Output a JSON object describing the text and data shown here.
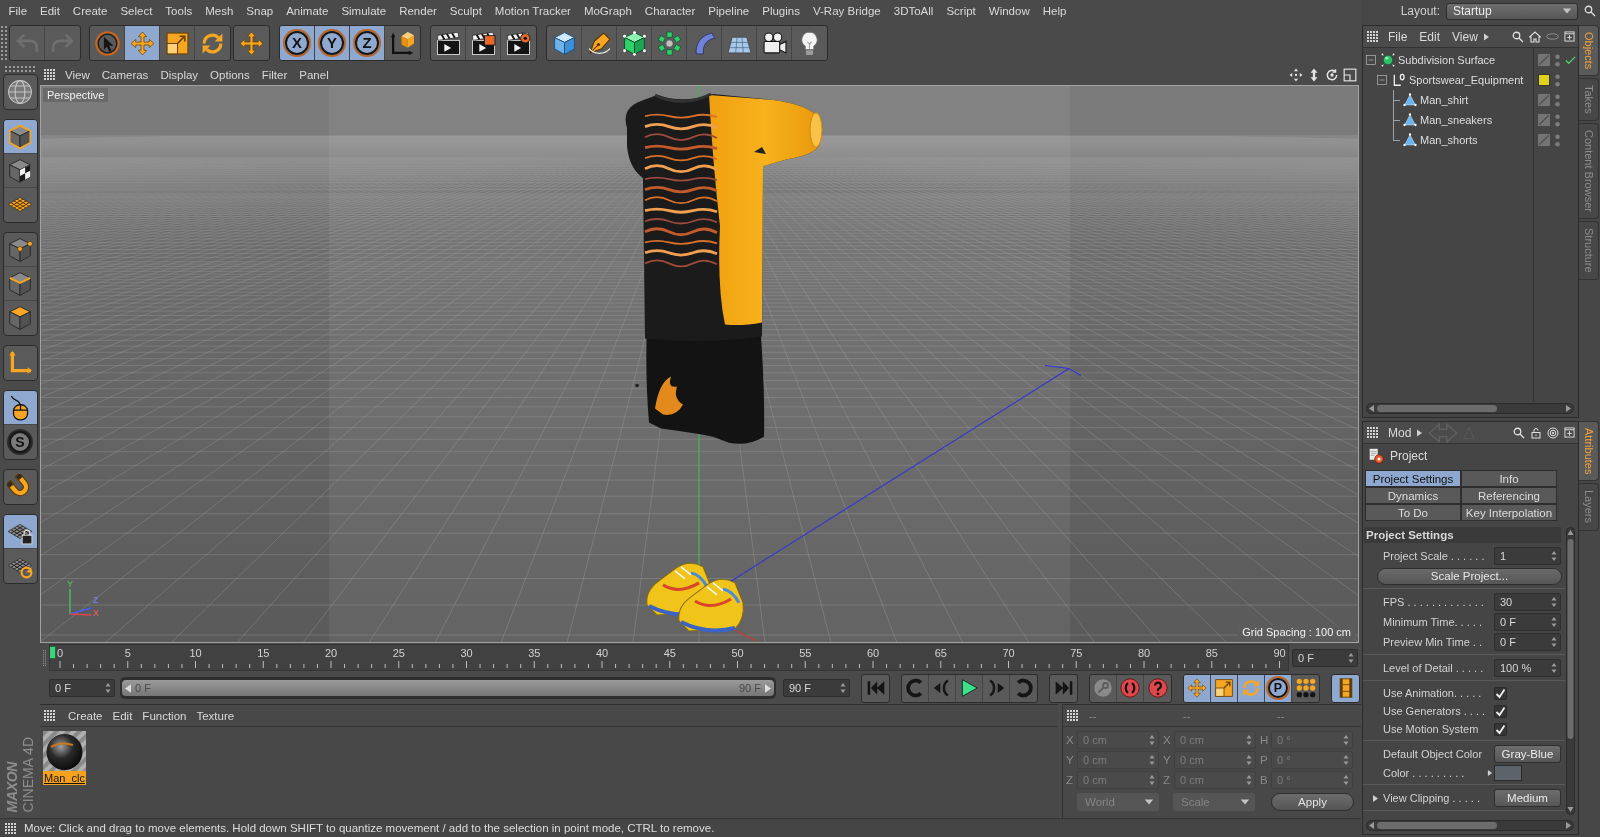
{
  "menu_bar": {
    "items": [
      "File",
      "Edit",
      "Create",
      "Select",
      "Tools",
      "Mesh",
      "Snap",
      "Animate",
      "Simulate",
      "Render",
      "Sculpt",
      "Motion Tracker",
      "MoGraph",
      "Character",
      "Pipeline",
      "Plugins",
      "V-Ray Bridge",
      "3DToAll",
      "Script",
      "Window",
      "Help"
    ]
  },
  "layout": {
    "label": "Layout:",
    "value": "Startup"
  },
  "toolbar": {
    "groups": [
      [
        {
          "kind": "undo",
          "disabled": true
        },
        {
          "kind": "redo",
          "disabled": true
        }
      ],
      [
        {
          "kind": "select",
          "selected": false
        },
        {
          "kind": "move",
          "selected": true
        },
        {
          "kind": "scale",
          "selected": false
        },
        {
          "kind": "rotate",
          "selected": false
        }
      ],
      [
        {
          "kind": "move",
          "selected": false
        }
      ],
      [
        {
          "kind": "axis",
          "label": "X",
          "selected": true
        },
        {
          "kind": "axis",
          "label": "Y",
          "selected": true
        },
        {
          "kind": "axis",
          "label": "Z",
          "selected": true
        },
        {
          "kind": "coordinate-system",
          "selected": false
        }
      ],
      [
        {
          "kind": "render-view",
          "selected": false
        },
        {
          "kind": "render-picture-viewer",
          "selected": false
        },
        {
          "kind": "render-settings",
          "selected": false
        }
      ],
      [
        {
          "kind": "cube",
          "selected": false
        },
        {
          "kind": "pen",
          "selected": false
        },
        {
          "kind": "subdivision",
          "selected": false
        },
        {
          "kind": "cloner",
          "selected": false
        },
        {
          "kind": "bend",
          "selected": false
        },
        {
          "kind": "floor",
          "selected": false
        },
        {
          "kind": "camera",
          "selected": false
        },
        {
          "kind": "light",
          "selected": false
        }
      ]
    ]
  },
  "left_toolbar": {
    "groups": [
      [
        {
          "kind": "make-editable",
          "selected": false
        }
      ],
      [
        {
          "kind": "model",
          "selected": true
        },
        {
          "kind": "texture",
          "selected": false
        },
        {
          "kind": "workplane",
          "selected": false
        }
      ],
      [
        {
          "kind": "points",
          "selected": false
        },
        {
          "kind": "edges",
          "selected": false
        },
        {
          "kind": "polygons",
          "selected": false
        }
      ],
      [
        {
          "kind": "axis-mode",
          "selected": false
        }
      ],
      [
        {
          "kind": "tweak",
          "selected": true
        },
        {
          "kind": "solo",
          "label": "S",
          "selected": false
        }
      ],
      [
        {
          "kind": "snap",
          "selected": false
        }
      ],
      [
        {
          "kind": "workplane-lock",
          "selected": true
        },
        {
          "kind": "planar",
          "selected": false
        }
      ]
    ]
  },
  "viewport": {
    "menu": [
      "View",
      "Cameras",
      "Display",
      "Options",
      "Filter",
      "Panel"
    ],
    "camera": "Perspective",
    "grid_spacing": "Grid Spacing : 100 cm",
    "axis_gizmo": [
      "Y",
      "Z",
      "X"
    ]
  },
  "timeline": {
    "ruler_labels": [
      "0",
      "5",
      "10",
      "15",
      "20",
      "25",
      "30",
      "35",
      "40",
      "45",
      "50",
      "55",
      "60",
      "65",
      "70",
      "75",
      "80",
      "85",
      "90"
    ],
    "current_frame": "0 F",
    "min_field": "0 F",
    "range_slider": {
      "start": "0 F",
      "end": "90 F",
      "level": 1
    },
    "max_field": "90 F"
  },
  "transport": {
    "groups": [
      [
        {
          "kind": "go-start",
          "selected": false
        }
      ],
      [
        {
          "kind": "prev-key",
          "selected": false
        },
        {
          "kind": "prev-frame",
          "selected": false
        },
        {
          "kind": "play",
          "selected": false
        },
        {
          "kind": "next-frame",
          "selected": false
        },
        {
          "kind": "next-key",
          "selected": false
        }
      ],
      [
        {
          "kind": "go-end",
          "selected": false
        }
      ],
      [
        {
          "kind": "record-key",
          "selected": false
        },
        {
          "kind": "record-active",
          "selected": false
        },
        {
          "kind": "autokey",
          "selected": false
        }
      ],
      [
        {
          "kind": "key-position",
          "selected": true
        },
        {
          "kind": "key-scale",
          "selected": true
        },
        {
          "kind": "key-rotation",
          "selected": true
        },
        {
          "kind": "key-parameter",
          "label": "P",
          "selected": true
        },
        {
          "kind": "key-points",
          "selected": false
        }
      ],
      [
        {
          "kind": "timeline",
          "selected": true
        }
      ]
    ]
  },
  "material_manager": {
    "menu": [
      "Create",
      "Edit",
      "Function",
      "Texture"
    ],
    "materials": [
      {
        "name": "Man_clc",
        "selected": true
      }
    ]
  },
  "coordinates": {
    "disabled": true,
    "headers": [
      "--",
      "--",
      "--"
    ],
    "rows": [
      [
        {
          "axis": "X",
          "value": "0 cm"
        },
        {
          "axis": "X",
          "value": "0 cm"
        },
        {
          "axis": "H",
          "value": "0 °"
        }
      ],
      [
        {
          "axis": "Y",
          "value": "0 cm"
        },
        {
          "axis": "Y",
          "value": "0 cm"
        },
        {
          "axis": "P",
          "value": "0 °"
        }
      ],
      [
        {
          "axis": "Z",
          "value": "0 cm"
        },
        {
          "axis": "Z",
          "value": "0 cm"
        },
        {
          "axis": "B",
          "value": "0 °"
        }
      ]
    ],
    "dropdowns": [
      "World",
      "Scale"
    ],
    "apply": "Apply"
  },
  "logo": {
    "brand": "MAXON",
    "product": "CINEMA 4D"
  },
  "status_bar": {
    "text": "Move: Click and drag to move elements. Hold down SHIFT to quantize movement / add to the selection in point mode, CTRL to remove."
  },
  "objects_manager": {
    "menu": [
      "File",
      "Edit",
      "View"
    ],
    "tree": [
      {
        "name": "Subdivision Surface",
        "kind": "subdivision",
        "expanded": true,
        "checked": true,
        "children": [
          {
            "name": "Sportswear_Equipment",
            "kind": "null",
            "expanded": true,
            "color": "#e2d21c",
            "children": [
              {
                "name": "Man_shirt",
                "kind": "polygon"
              },
              {
                "name": "Man_sneakers",
                "kind": "polygon"
              },
              {
                "name": "Man_shorts",
                "kind": "polygon"
              }
            ]
          }
        ]
      }
    ]
  },
  "objects_side_tabs": [
    {
      "label": "Objects",
      "selected": true
    },
    {
      "label": "Takes",
      "selected": false
    },
    {
      "label": "Content Browser",
      "selected": false
    },
    {
      "label": "Structure",
      "selected": false
    }
  ],
  "attributes_manager": {
    "mode": "Mod",
    "object": "Project",
    "tabs": [
      {
        "label": "Project Settings",
        "selected": true
      },
      {
        "label": "Info",
        "selected": false
      },
      {
        "label": "Dynamics",
        "selected": false
      },
      {
        "label": "Referencing",
        "selected": false
      },
      {
        "label": "To Do",
        "selected": false
      },
      {
        "label": "Key Interpolation",
        "selected": false
      }
    ],
    "section": "Project Settings",
    "groups": [
      [
        {
          "kind": "number",
          "label": "Project Scale . . . . . .",
          "value": "1"
        },
        {
          "kind": "button",
          "label": "Scale Project..."
        }
      ],
      [
        {
          "kind": "number",
          "label": "FPS . . . . . . . . . . . . .",
          "value": "30"
        },
        {
          "kind": "number",
          "label": "Minimum Time. . . . .",
          "value": "0 F"
        },
        {
          "kind": "number",
          "label": "Preview Min Time . .",
          "value": "0 F"
        }
      ],
      [
        {
          "kind": "number",
          "label": "Level of Detail . . . . .",
          "value": "100 %"
        }
      ],
      [
        {
          "kind": "checkbox",
          "label": "Use Animation. . . . .",
          "checked": true
        },
        {
          "kind": "checkbox",
          "label": "Use Generators . . . .",
          "checked": true
        },
        {
          "kind": "checkbox",
          "label": "Use Motion System",
          "checked": true
        }
      ],
      [
        {
          "kind": "dropdown",
          "label": "Default Object Color",
          "value": "Gray-Blue"
        },
        {
          "kind": "color",
          "label": "Color . . . . . . . . .",
          "color": "#5d636b",
          "expanded": false
        }
      ],
      [
        {
          "kind": "dropdown",
          "label": "View Clipping . . . . .",
          "value": "Medium",
          "expanded": false
        }
      ]
    ]
  },
  "attributes_side_tabs": [
    {
      "label": "Attributes",
      "selected": true
    },
    {
      "label": "Layers",
      "selected": false
    }
  ]
}
